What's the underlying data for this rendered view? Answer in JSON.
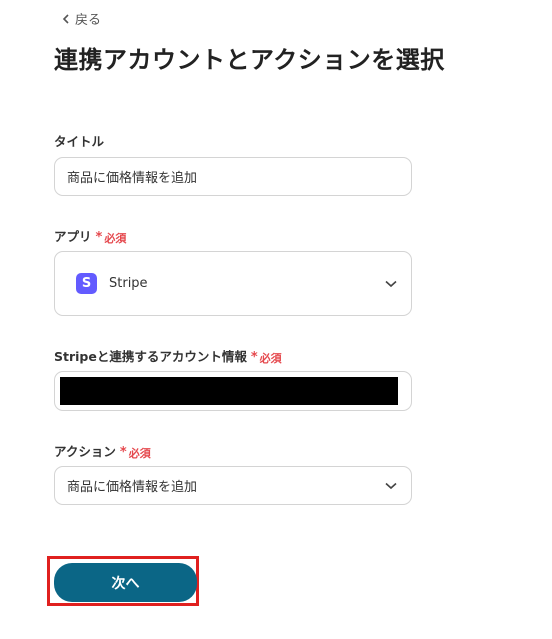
{
  "back": {
    "label": "戻る"
  },
  "page_title": "連携アカウントとアクションを選択",
  "required_label": "必須",
  "required_mark": "*",
  "title_field": {
    "label": "タイトル",
    "value": "商品に価格情報を追加"
  },
  "app_field": {
    "label": "アプリ",
    "selected": "Stripe",
    "logo_letter": "S",
    "logo_color": "#635bff"
  },
  "account_field": {
    "label": "Stripeと連携するアカウント情報",
    "value_redacted": true
  },
  "action_field": {
    "label": "アクション",
    "selected": "商品に価格情報を追加"
  },
  "next_button": {
    "label": "次へ",
    "color": "#0b6686",
    "highlight_color": "#e0201f"
  },
  "icons": [
    "chevron-left-icon",
    "chevron-down-icon",
    "stripe-logo-icon"
  ]
}
